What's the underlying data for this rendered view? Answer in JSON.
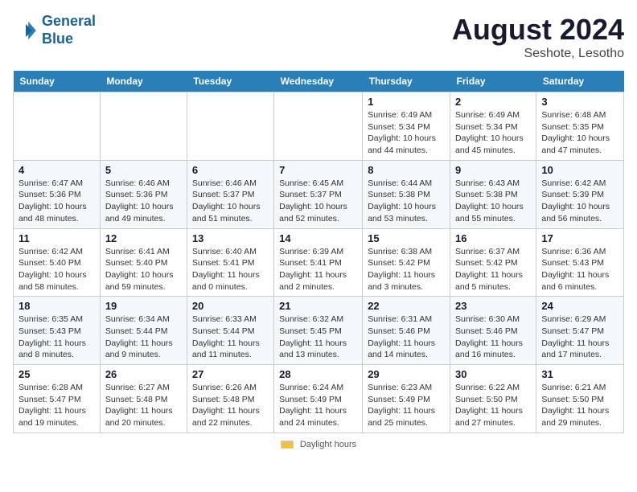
{
  "logo": {
    "line1": "General",
    "line2": "Blue"
  },
  "title": {
    "month_year": "August 2024",
    "location": "Seshote, Lesotho"
  },
  "days_of_week": [
    "Sunday",
    "Monday",
    "Tuesday",
    "Wednesday",
    "Thursday",
    "Friday",
    "Saturday"
  ],
  "weeks": [
    [
      {
        "day": "",
        "info": ""
      },
      {
        "day": "",
        "info": ""
      },
      {
        "day": "",
        "info": ""
      },
      {
        "day": "",
        "info": ""
      },
      {
        "day": "1",
        "info": "Sunrise: 6:49 AM\nSunset: 5:34 PM\nDaylight: 10 hours\nand 44 minutes."
      },
      {
        "day": "2",
        "info": "Sunrise: 6:49 AM\nSunset: 5:34 PM\nDaylight: 10 hours\nand 45 minutes."
      },
      {
        "day": "3",
        "info": "Sunrise: 6:48 AM\nSunset: 5:35 PM\nDaylight: 10 hours\nand 47 minutes."
      }
    ],
    [
      {
        "day": "4",
        "info": "Sunrise: 6:47 AM\nSunset: 5:36 PM\nDaylight: 10 hours\nand 48 minutes."
      },
      {
        "day": "5",
        "info": "Sunrise: 6:46 AM\nSunset: 5:36 PM\nDaylight: 10 hours\nand 49 minutes."
      },
      {
        "day": "6",
        "info": "Sunrise: 6:46 AM\nSunset: 5:37 PM\nDaylight: 10 hours\nand 51 minutes."
      },
      {
        "day": "7",
        "info": "Sunrise: 6:45 AM\nSunset: 5:37 PM\nDaylight: 10 hours\nand 52 minutes."
      },
      {
        "day": "8",
        "info": "Sunrise: 6:44 AM\nSunset: 5:38 PM\nDaylight: 10 hours\nand 53 minutes."
      },
      {
        "day": "9",
        "info": "Sunrise: 6:43 AM\nSunset: 5:38 PM\nDaylight: 10 hours\nand 55 minutes."
      },
      {
        "day": "10",
        "info": "Sunrise: 6:42 AM\nSunset: 5:39 PM\nDaylight: 10 hours\nand 56 minutes."
      }
    ],
    [
      {
        "day": "11",
        "info": "Sunrise: 6:42 AM\nSunset: 5:40 PM\nDaylight: 10 hours\nand 58 minutes."
      },
      {
        "day": "12",
        "info": "Sunrise: 6:41 AM\nSunset: 5:40 PM\nDaylight: 10 hours\nand 59 minutes."
      },
      {
        "day": "13",
        "info": "Sunrise: 6:40 AM\nSunset: 5:41 PM\nDaylight: 11 hours\nand 0 minutes."
      },
      {
        "day": "14",
        "info": "Sunrise: 6:39 AM\nSunset: 5:41 PM\nDaylight: 11 hours\nand 2 minutes."
      },
      {
        "day": "15",
        "info": "Sunrise: 6:38 AM\nSunset: 5:42 PM\nDaylight: 11 hours\nand 3 minutes."
      },
      {
        "day": "16",
        "info": "Sunrise: 6:37 AM\nSunset: 5:42 PM\nDaylight: 11 hours\nand 5 minutes."
      },
      {
        "day": "17",
        "info": "Sunrise: 6:36 AM\nSunset: 5:43 PM\nDaylight: 11 hours\nand 6 minutes."
      }
    ],
    [
      {
        "day": "18",
        "info": "Sunrise: 6:35 AM\nSunset: 5:43 PM\nDaylight: 11 hours\nand 8 minutes."
      },
      {
        "day": "19",
        "info": "Sunrise: 6:34 AM\nSunset: 5:44 PM\nDaylight: 11 hours\nand 9 minutes."
      },
      {
        "day": "20",
        "info": "Sunrise: 6:33 AM\nSunset: 5:44 PM\nDaylight: 11 hours\nand 11 minutes."
      },
      {
        "day": "21",
        "info": "Sunrise: 6:32 AM\nSunset: 5:45 PM\nDaylight: 11 hours\nand 13 minutes."
      },
      {
        "day": "22",
        "info": "Sunrise: 6:31 AM\nSunset: 5:46 PM\nDaylight: 11 hours\nand 14 minutes."
      },
      {
        "day": "23",
        "info": "Sunrise: 6:30 AM\nSunset: 5:46 PM\nDaylight: 11 hours\nand 16 minutes."
      },
      {
        "day": "24",
        "info": "Sunrise: 6:29 AM\nSunset: 5:47 PM\nDaylight: 11 hours\nand 17 minutes."
      }
    ],
    [
      {
        "day": "25",
        "info": "Sunrise: 6:28 AM\nSunset: 5:47 PM\nDaylight: 11 hours\nand 19 minutes."
      },
      {
        "day": "26",
        "info": "Sunrise: 6:27 AM\nSunset: 5:48 PM\nDaylight: 11 hours\nand 20 minutes."
      },
      {
        "day": "27",
        "info": "Sunrise: 6:26 AM\nSunset: 5:48 PM\nDaylight: 11 hours\nand 22 minutes."
      },
      {
        "day": "28",
        "info": "Sunrise: 6:24 AM\nSunset: 5:49 PM\nDaylight: 11 hours\nand 24 minutes."
      },
      {
        "day": "29",
        "info": "Sunrise: 6:23 AM\nSunset: 5:49 PM\nDaylight: 11 hours\nand 25 minutes."
      },
      {
        "day": "30",
        "info": "Sunrise: 6:22 AM\nSunset: 5:50 PM\nDaylight: 11 hours\nand 27 minutes."
      },
      {
        "day": "31",
        "info": "Sunrise: 6:21 AM\nSunset: 5:50 PM\nDaylight: 11 hours\nand 29 minutes."
      }
    ]
  ],
  "footer": {
    "daylight_label": "Daylight hours"
  }
}
